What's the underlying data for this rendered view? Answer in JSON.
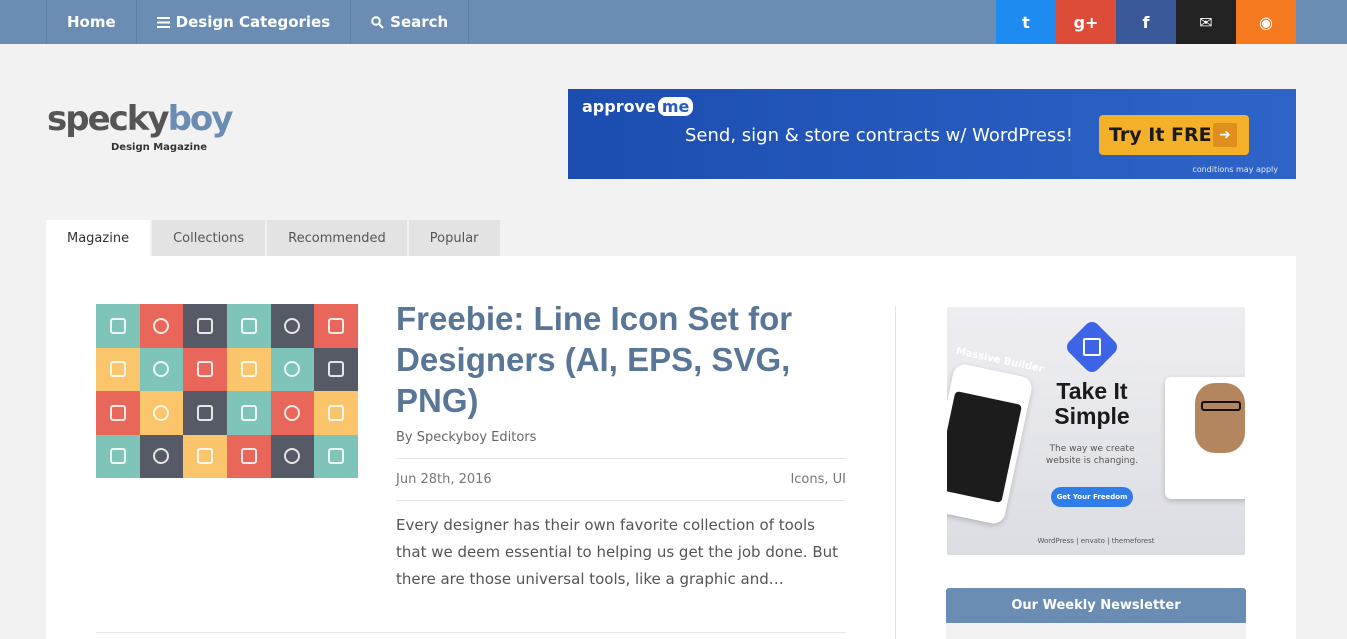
{
  "topnav": {
    "items": [
      {
        "label": "Home",
        "icon": ""
      },
      {
        "label": "Design Categories",
        "icon": "menu-icon"
      },
      {
        "label": "Search",
        "icon": "search-icon"
      }
    ],
    "social": [
      {
        "icon": "twitter-icon",
        "glyph": "t",
        "color": "#1d8bf0"
      },
      {
        "icon": "google-plus-icon",
        "glyph": "g+",
        "color": "#dd4b39"
      },
      {
        "icon": "facebook-icon",
        "glyph": "f",
        "color": "#3b5998"
      },
      {
        "icon": "email-icon",
        "glyph": "✉",
        "color": "#222222"
      },
      {
        "icon": "rss-icon",
        "glyph": "◉",
        "color": "#f5791f"
      }
    ]
  },
  "logo": {
    "word_a": "specky",
    "word_b": "boy",
    "tagline": "Design Magazine"
  },
  "banner": {
    "brand": "approve",
    "brand_badge": "me",
    "headline": "Send, sign & store contracts w/ WordPress!",
    "button": "Try It FREE",
    "fine_print": "conditions may apply"
  },
  "tabs": [
    "Magazine",
    "Collections",
    "Recommended",
    "Popular"
  ],
  "article": {
    "title": "Freebie: Line Icon Set for Designers (AI, EPS, SVG, PNG)",
    "byline": "By Speckyboy Editors",
    "date": "Jun 28th, 2016",
    "categories": "Icons, UI",
    "excerpt": "Every designer has their own favorite collection of tools that we deem essential to helping us get the job done. But there are those universal tools, like a graphic and…",
    "thumb_colors": [
      "#7ec4b8",
      "#e9675a",
      "#565a66",
      "#7ec4b8",
      "#565a66",
      "#e9675a",
      "#fbc56c",
      "#7ec4b8",
      "#e9675a",
      "#fbc56c",
      "#7ec4b8",
      "#565a66",
      "#e9675a",
      "#fbc56c",
      "#565a66",
      "#7ec4b8",
      "#e9675a",
      "#fbc56c",
      "#7ec4b8",
      "#565a66",
      "#fbc56c",
      "#e9675a",
      "#565a66",
      "#7ec4b8"
    ]
  },
  "sidebar_ad": {
    "headline": "Take It Simple",
    "sub": "The way we create website is changing.",
    "button": "Get Your Freedom",
    "phone_label": "Massive Builder",
    "footer": "WordPress  |  envato  |  themeforest"
  },
  "newsletter": {
    "title": "Our Weekly Newsletter"
  }
}
